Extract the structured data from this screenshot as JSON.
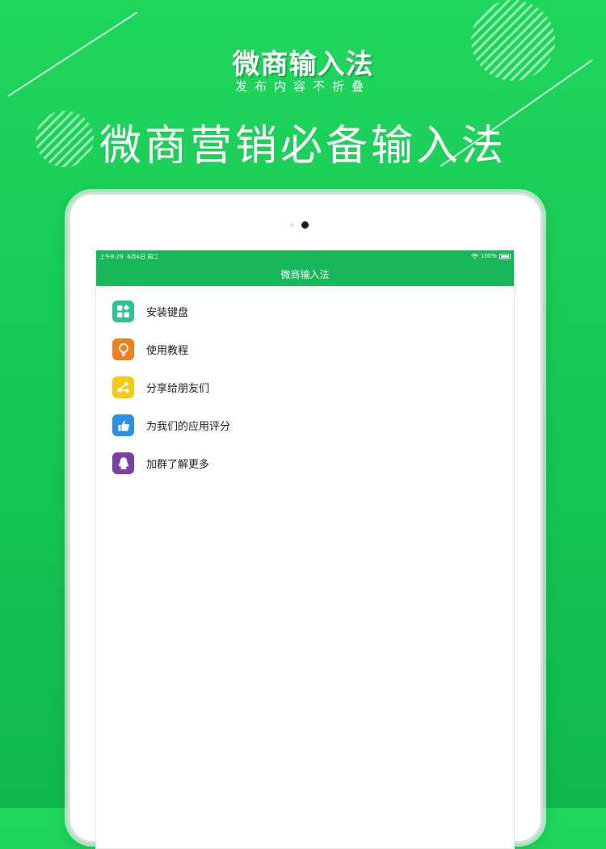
{
  "promo": {
    "title": "微商输入法",
    "subtitle": "发布内容不折叠",
    "headline": "微商营销必备输入法"
  },
  "status_bar": {
    "time": "上午8:29",
    "date": "6月4日 周二",
    "battery": "100%"
  },
  "nav": {
    "title": "微商输入法"
  },
  "menu": [
    {
      "label": "安装键盘",
      "icon": "grid-icon",
      "color": "#2ec28e"
    },
    {
      "label": "使用教程",
      "icon": "lightbulb-icon",
      "color": "#f07f1e"
    },
    {
      "label": "分享给朋友们",
      "icon": "share-icon",
      "color": "#f6c912"
    },
    {
      "label": "为我们的应用评分",
      "icon": "thumbs-up-icon",
      "color": "#2b8fe6"
    },
    {
      "label": "加群了解更多",
      "icon": "qq-penguin-icon",
      "color": "#7d3fa3"
    }
  ],
  "colors": {
    "background": "#16c653",
    "accent": "#18b85a"
  }
}
